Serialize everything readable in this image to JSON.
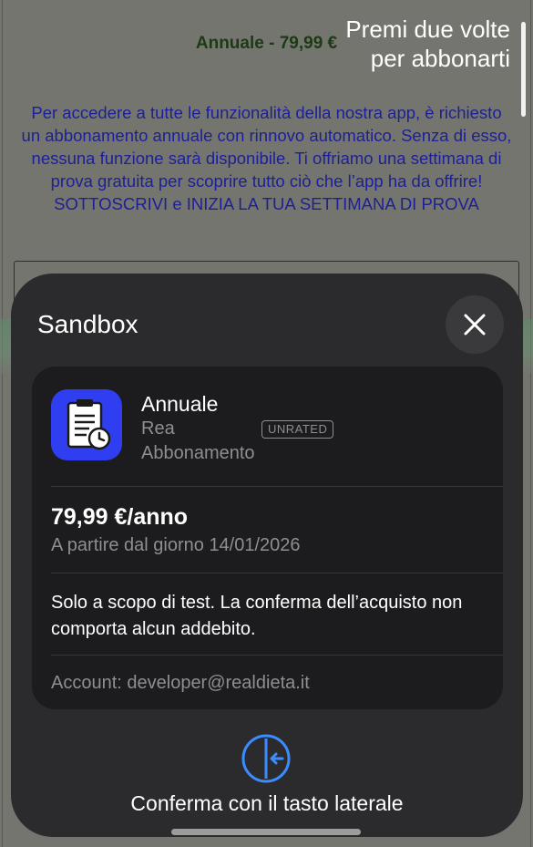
{
  "background": {
    "price_line": "Annuale - 79,99 €",
    "description": "Per accedere a tutte le funzionalità della nostra app, è richiesto un abbonamento annuale con rinnovo automatico. Senza di esso, nessuna funzione sarà disponibile. Ti offriamo una settimana di prova gratuita per scoprire tutto ciò che l’app ha da offrire! SOTTOSCRIVI e INIZIA LA TUA SETTIMANA DI PROVA"
  },
  "hint": {
    "line1": "Premi due volte",
    "line2": "per abbonarti"
  },
  "sheet": {
    "title": "Sandbox",
    "close_icon": "close-icon",
    "product": {
      "name": "Annuale",
      "developer": "Rea",
      "rating_badge": "UNRATED",
      "type": "Abbonamento",
      "icon": "clipboard-clock-icon"
    },
    "price": "79,99 €/anno",
    "start_date": "A partire dal giorno 14/01/2026",
    "note": "Solo a scopo di test. La conferma dell’acquisto non comporta alcun addebito.",
    "account": "Account: developer@realdieta.it",
    "confirm_icon": "side-button-icon",
    "confirm_text": "Conferma con il tasto laterale"
  },
  "colors": {
    "accent": "#2f3ef0",
    "confirm_icon": "#3b8cff",
    "sheet_bg": "#2b2b2d",
    "card_bg": "#1c1c1e"
  }
}
